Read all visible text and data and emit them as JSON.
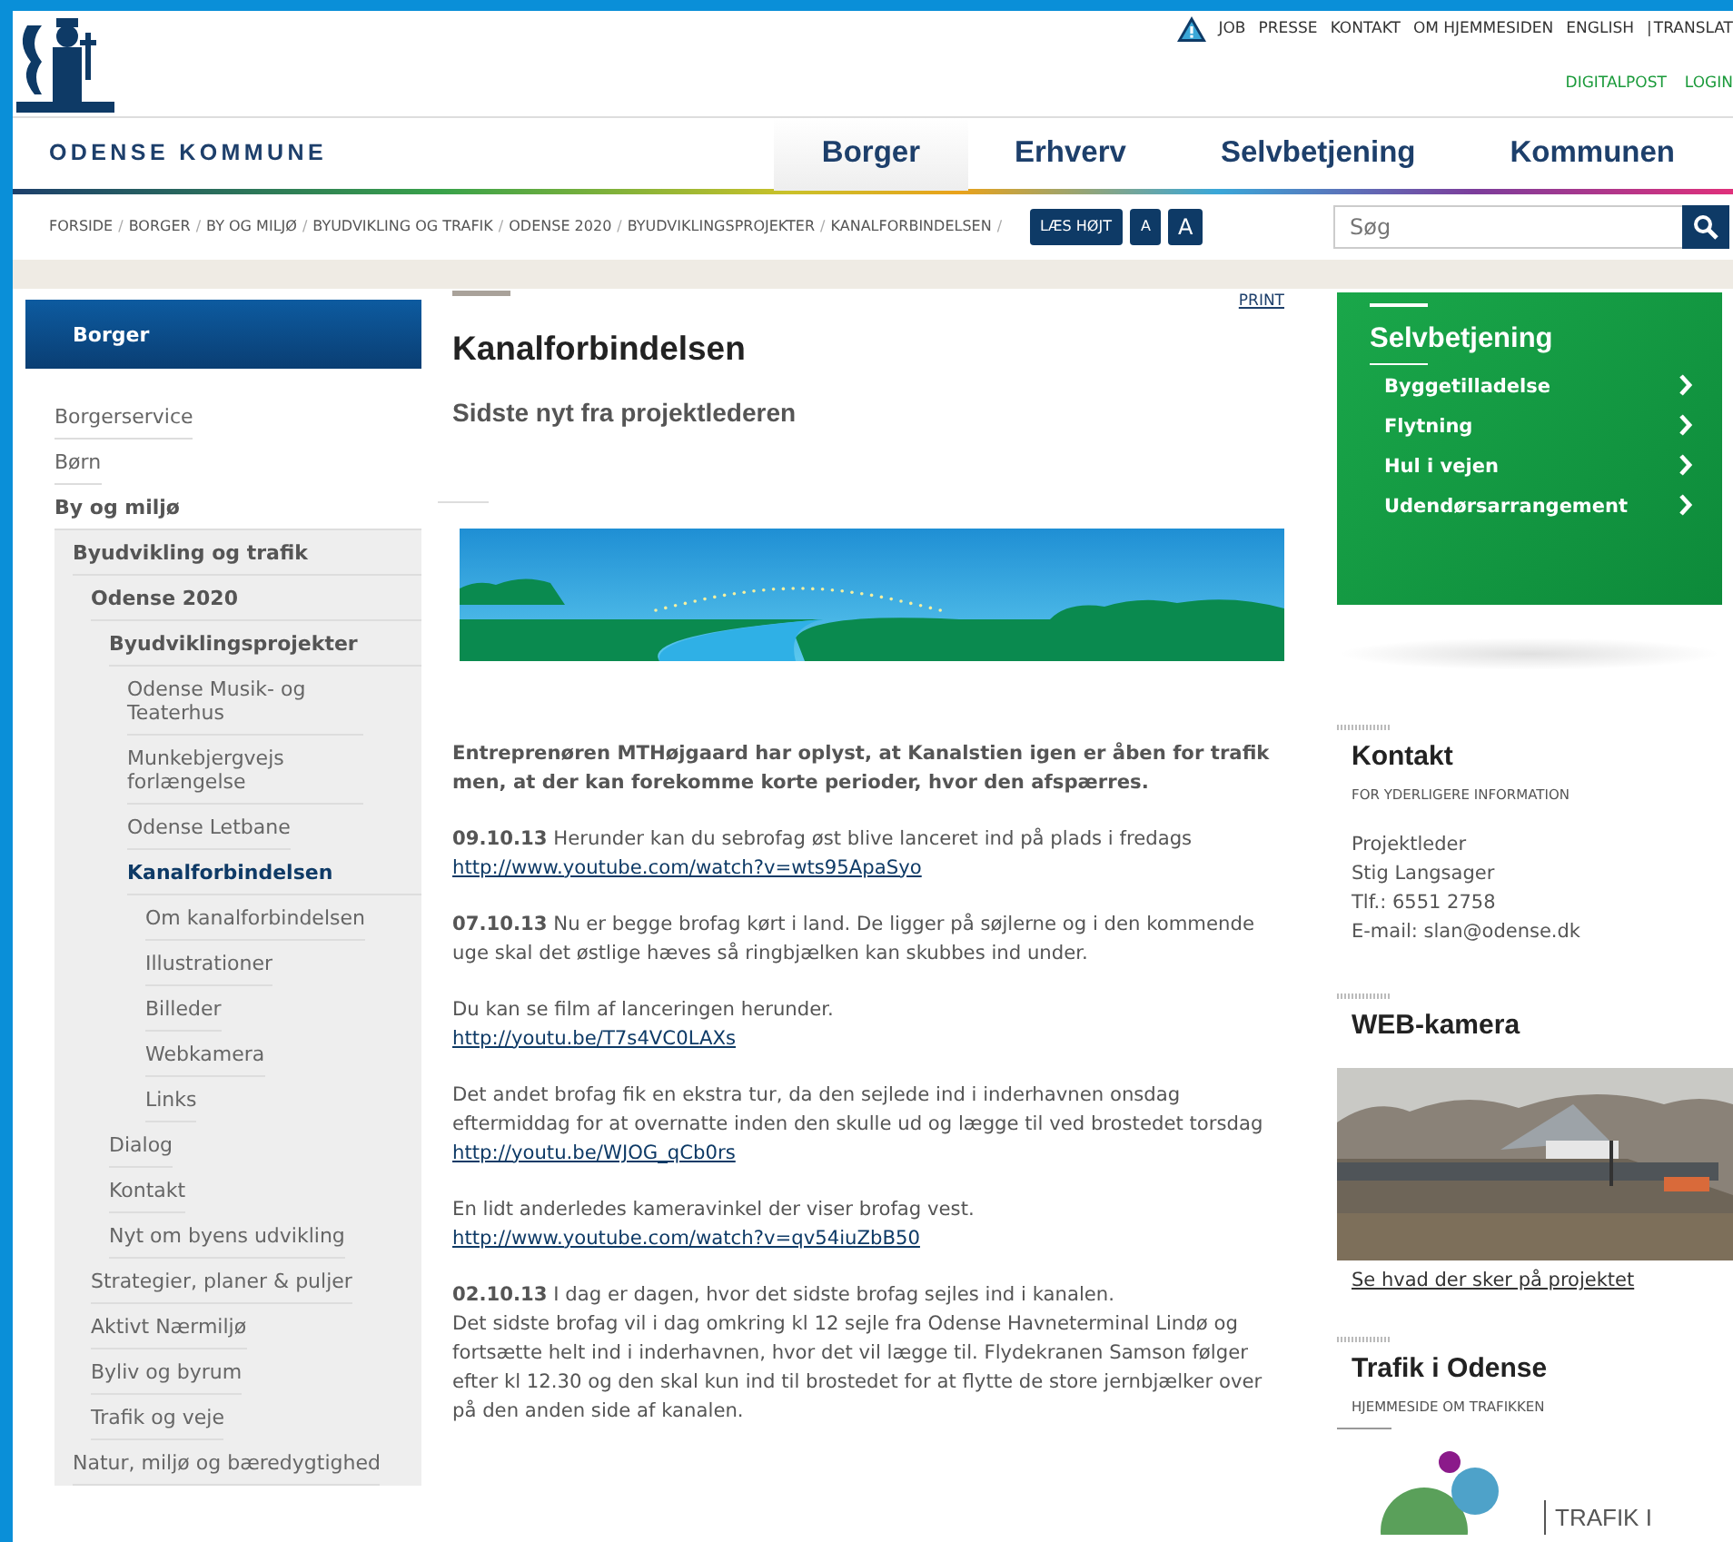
{
  "header": {
    "utility_links": [
      {
        "kind": "link",
        "text": "JOB"
      },
      {
        "kind": "link",
        "text": "PRESSE"
      },
      {
        "kind": "link",
        "text": "KONTAKT"
      },
      {
        "kind": "link",
        "text": "OM HJEMMESIDEN"
      },
      {
        "kind": "link",
        "text": "ENGLISH"
      },
      {
        "kind": "separator",
        "text": "|"
      },
      {
        "kind": "link",
        "text": "TRANSLAT"
      }
    ],
    "secondary_links": [
      "DIGITALPOST",
      "LOGIN"
    ],
    "site_name": "ODENSE KOMMUNE",
    "tabs": [
      {
        "label": "Borger",
        "selected": true
      },
      {
        "label": "Erhverv",
        "selected": false
      },
      {
        "label": "Selvbetjening",
        "selected": false
      },
      {
        "label": "Kommunen",
        "selected": false
      }
    ]
  },
  "breadcrumb": {
    "separator": "/",
    "items": [
      "FORSIDE",
      "BORGER",
      "BY OG MILJØ",
      "BYUDVIKLING OG TRAFIK",
      "ODENSE 2020",
      "BYUDVIKLINGSPROJEKTER",
      "KANALFORBINDELSEN"
    ]
  },
  "tools": {
    "read_aloud": "LÆS HØJT",
    "text_small": "A",
    "text_large": "A"
  },
  "search": {
    "placeholder": "Søg"
  },
  "sidebar": {
    "title": "Borger",
    "items": [
      {
        "label": "Borgerservice",
        "selected": false,
        "expanded": false
      },
      {
        "label": "Børn",
        "selected": false,
        "expanded": false
      },
      {
        "label": "By og miljø",
        "selected": false,
        "expanded": true,
        "children": [
          {
            "label": "Byudvikling og trafik",
            "selected": false,
            "expanded": true,
            "children": [
              {
                "label": "Odense 2020",
                "selected": false,
                "expanded": true,
                "children": [
                  {
                    "label": "Byudviklingsprojekter",
                    "selected": false,
                    "expanded": true,
                    "children": [
                      {
                        "label": "Odense Musik- og Teaterhus",
                        "selected": false,
                        "expanded": false
                      },
                      {
                        "label": "Munkebjergvejs forlængelse",
                        "selected": false,
                        "expanded": false
                      },
                      {
                        "label": "Odense Letbane",
                        "selected": false,
                        "expanded": false
                      },
                      {
                        "label": "Kanalforbindelsen",
                        "selected": true,
                        "expanded": true,
                        "children": [
                          {
                            "label": "Om kanalforbindelsen",
                            "selected": false,
                            "expanded": false
                          },
                          {
                            "label": "Illustrationer",
                            "selected": false,
                            "expanded": false
                          },
                          {
                            "label": "Billeder",
                            "selected": false,
                            "expanded": false
                          },
                          {
                            "label": "Webkamera",
                            "selected": false,
                            "expanded": false
                          },
                          {
                            "label": "Links",
                            "selected": false,
                            "expanded": false
                          }
                        ]
                      }
                    ]
                  },
                  {
                    "label": "Dialog",
                    "selected": false,
                    "expanded": false
                  },
                  {
                    "label": "Kontakt",
                    "selected": false,
                    "expanded": false
                  },
                  {
                    "label": "Nyt om byens udvikling",
                    "selected": false,
                    "expanded": false
                  }
                ]
              },
              {
                "label": "Strategier, planer & puljer",
                "selected": false,
                "expanded": false
              },
              {
                "label": "Aktivt Nærmiljø",
                "selected": false,
                "expanded": false
              },
              {
                "label": "Byliv og byrum",
                "selected": false,
                "expanded": false
              },
              {
                "label": "Trafik og veje",
                "selected": false,
                "expanded": false
              }
            ]
          },
          {
            "label": "Natur, miljø og bæredygtighed",
            "selected": false,
            "expanded": false
          }
        ]
      }
    ]
  },
  "article": {
    "print": "PRINT",
    "title": "Kanalforbindelsen",
    "subtitle": "Sidste nyt fra projektlederen",
    "paragraphs": [
      [
        {
          "kind": "lead",
          "text": "Entreprenøren MTHøjgaard har oplyst, at Kanalstien igen er åben for trafik men, at der kan forekomme korte perioder, hvor den afspærres."
        }
      ],
      [
        {
          "kind": "text",
          "text": "**09.10.13** Herunder kan du sebrofag øst blive lanceret ind på plads i fredags"
        },
        {
          "kind": "link",
          "text": "http://www.youtube.com/watch?v=wts95ApaSyo"
        }
      ],
      [
        {
          "kind": "text",
          "text": "**07.10.13** Nu er begge brofag kørt i land. De ligger på søjlerne og i den kommende uge skal det østlige hæves så ringbjælken kan skubbes ind under."
        }
      ],
      [
        {
          "kind": "text",
          "text": "Du kan se film af lanceringen herunder."
        },
        {
          "kind": "link",
          "text": "http://youtu.be/T7s4VC0LAXs"
        }
      ],
      [
        {
          "kind": "text",
          "text": "Det andet brofag fik en ekstra tur, da den sejlede ind i inderhavnen onsdag eftermiddag for at overnatte inden den skulle ud og lægge til ved brostedet torsdag"
        },
        {
          "kind": "link",
          "text": "http://youtu.be/WJOG_qCb0rs"
        }
      ],
      [
        {
          "kind": "text",
          "text": "En lidt anderledes kameravinkel der viser brofag vest."
        },
        {
          "kind": "link",
          "text": "http://www.youtube.com/watch?v=qv54iuZbB50"
        }
      ],
      [
        {
          "kind": "text",
          "text": "**02.10.13** I dag er dagen, hvor det sidste brofag sejles ind i kanalen."
        },
        {
          "kind": "text",
          "text": "Det sidste brofag vil i dag omkring kl 12 sejle fra Odense Havneterminal Lindø og fortsætte helt ind i inderhavnen, hvor det vil lægge til. Flydekranen Samson følger efter kl 12.30 og den skal kun ind til brostedet for at flytte de store jernbjælker over på den anden side af kanalen."
        }
      ]
    ]
  },
  "aside": {
    "selfservice": {
      "title": "Selvbetjening",
      "items": [
        "Byggetilladelse",
        "Flytning",
        "Hul i vejen",
        "Udendørsarrangement"
      ]
    },
    "contact": {
      "title": "Kontakt",
      "subtitle": "FOR YDERLIGERE INFORMATION",
      "lines": [
        "Projektleder",
        "Stig Langsager",
        "Tlf.: 6551 2758",
        "E-mail: slan@odense.dk"
      ]
    },
    "webcam": {
      "title": "WEB-kamera",
      "link": "Se hvad der sker på projektet"
    },
    "traffic": {
      "title": "Trafik i Odense",
      "subtitle": "HJEMMESIDE OM TRAFIKKEN",
      "logo_text": "TRAFIK I"
    }
  }
}
